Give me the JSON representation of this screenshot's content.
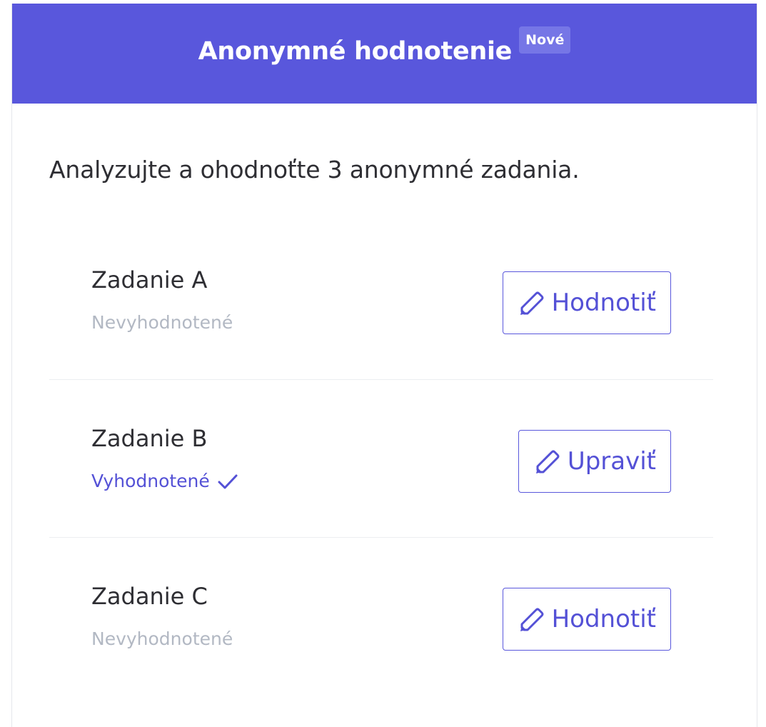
{
  "header": {
    "title": "Anonymné hodnotenie",
    "badge": "Nové",
    "background": "#5957dc"
  },
  "intro": "Analyzujte a ohodnoťte 3 anonymné zadania.",
  "assignments": [
    {
      "name": "Zadanie A",
      "status": "Nevyhodnotené",
      "evaluated": false,
      "button_label": "Hodnotiť",
      "button_icon": "pencil-icon"
    },
    {
      "name": "Zadanie B",
      "status": "Vyhodnotené",
      "evaluated": true,
      "button_label": "Upraviť",
      "button_icon": "pencil-icon"
    },
    {
      "name": "Zadanie C",
      "status": "Nevyhodnotené",
      "evaluated": false,
      "button_label": "Hodnotiť",
      "button_icon": "pencil-icon"
    }
  ],
  "colors": {
    "accent": "#5451d6",
    "muted_status": "#b2b8c3",
    "text": "#2e2e33"
  }
}
